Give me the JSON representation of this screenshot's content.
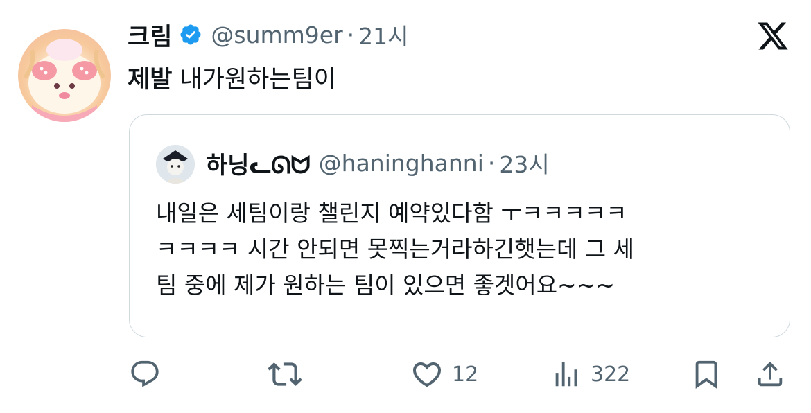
{
  "tweet": {
    "author_name": "크림",
    "handle": "@summ9er",
    "separator": "·",
    "time": "21시",
    "text_bold": "제발",
    "text_rest": " 내가원하는팀이"
  },
  "quoted_tweet": {
    "author_name": "하닝ᓚᘏᗢ",
    "handle": "@haninghanni",
    "separator": "·",
    "time": "23시",
    "lines": [
      "내일은 세팀이랑 챌린지 예약있다함 ㅜㅋㅋㅋㅋㅋ",
      "ㅋㅋㅋㅋ 시간 안되면 못찍는거라하긴햇는데 그 세",
      "팀 중에 제가 원하는 팀이 있으면 좋겟어요~~~"
    ]
  },
  "actions": {
    "reply_icon": "reply-icon",
    "retweet_icon": "retweet-icon",
    "like_icon": "heart-icon",
    "like_count": "12",
    "views_icon": "views-icon",
    "views_count": "322",
    "bookmark_icon": "bookmark-icon",
    "share_icon": "share-icon"
  },
  "colors": {
    "verified": "#1d9bf0",
    "secondary_text": "#536471",
    "border": "#cfd9de"
  }
}
